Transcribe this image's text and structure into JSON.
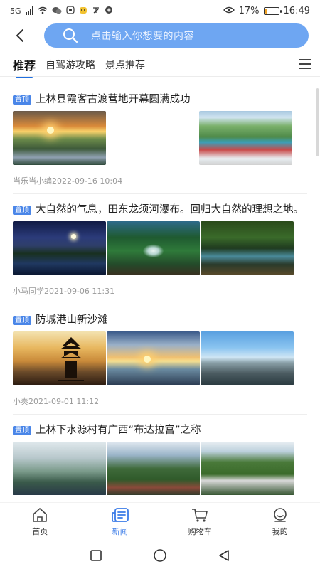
{
  "status_bar": {
    "network": "5G",
    "battery_percent": "17%",
    "battery_level": 0.17,
    "time": "16:49"
  },
  "header": {
    "back_icon": "chevron-left-icon",
    "search_placeholder": "点击输入你想要的内容"
  },
  "tabs": [
    {
      "label": "推荐",
      "active": true
    },
    {
      "label": "自驾游攻略",
      "active": false
    },
    {
      "label": "景点推荐",
      "active": false
    }
  ],
  "articles": [
    {
      "badge": "置顶",
      "title": "上林县霞客古渡营地开幕圆满成功",
      "meta": "当乐当小编2022-09-16 10:04",
      "images": [
        "img-sunset-field",
        "gap",
        "img-boats"
      ]
    },
    {
      "badge": "置顶",
      "title": "大自然的气息，田东龙须河瀑布。回归大自然的理想之地。",
      "meta": "小马同学2021-09-06 11:31",
      "images": [
        "img-night-river",
        "img-waterfall",
        "img-stream"
      ]
    },
    {
      "badge": "置顶",
      "title": "防城港山新沙滩",
      "meta": "小奏2021-09-01 11:12",
      "images": [
        "img-pavilion",
        "img-sunset-sea",
        "img-rocks"
      ]
    },
    {
      "badge": "置顶",
      "title": "上林下水源村有广西“布达拉宫”之称",
      "meta": "",
      "images": [
        "img-clouds-hut",
        "img-mountain-village",
        "img-village"
      ]
    }
  ],
  "bottom_nav": [
    {
      "label": "首页",
      "icon": "home-icon",
      "active": false
    },
    {
      "label": "新闻",
      "icon": "news-icon",
      "active": true
    },
    {
      "label": "购物车",
      "icon": "cart-icon",
      "active": false
    },
    {
      "label": "我的",
      "icon": "profile-icon",
      "active": false
    }
  ],
  "colors": {
    "accent": "#3a7be8",
    "search_bg": "#6ea6f2",
    "badge_bg": "#4a86e8"
  }
}
